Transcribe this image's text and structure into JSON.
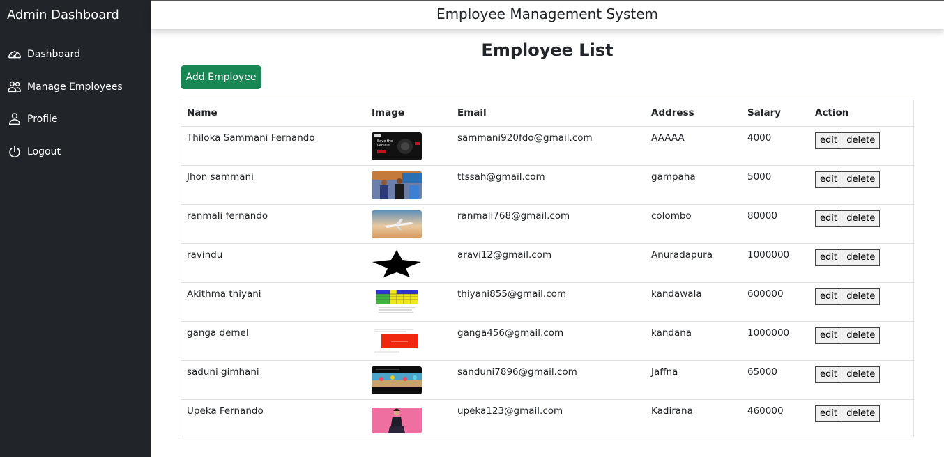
{
  "sidebar": {
    "brand": "Admin Dashboard",
    "items": [
      {
        "label": "Dashboard",
        "icon": "speedometer-icon"
      },
      {
        "label": "Manage Employees",
        "icon": "people-icon"
      },
      {
        "label": "Profile",
        "icon": "person-icon"
      },
      {
        "label": "Logout",
        "icon": "power-icon"
      }
    ]
  },
  "header": {
    "title": "Employee Management System"
  },
  "main": {
    "title": "Employee List",
    "add_button": "Add Employee",
    "columns": [
      "Name",
      "Image",
      "Email",
      "Address",
      "Salary",
      "Action"
    ],
    "rows": [
      {
        "name": "Thiloka Sammani Fernando",
        "email": "sammani920fdo@gmail.com",
        "address": "AAAAA",
        "salary": "4000",
        "image": "dark-website-thumbnail"
      },
      {
        "name": "Jhon sammani",
        "email": "ttssah@gmail.com",
        "address": "gampaha",
        "salary": "5000",
        "image": "graduation-photo-thumbnail"
      },
      {
        "name": "ranmali fernando",
        "email": "ranmali768@gmail.com",
        "address": "colombo",
        "salary": "80000",
        "image": "airplane-sky-thumbnail"
      },
      {
        "name": "ravindu",
        "email": "aravi12@gmail.com",
        "address": "Anuradapura",
        "salary": "1000000",
        "image": "black-star-thumbnail"
      },
      {
        "name": "Akithma thiyani",
        "email": "thiyani855@gmail.com",
        "address": "kandawala",
        "salary": "600000",
        "image": "color-table-thumbnail"
      },
      {
        "name": "ganga demel",
        "email": "ganga456@gmail.com",
        "address": "kandana",
        "salary": "1000000",
        "image": "red-banner-thumbnail"
      },
      {
        "name": "saduni gimhani",
        "email": "sanduni7896@gmail.com",
        "address": "Jaffna",
        "salary": "65000",
        "image": "beach-banner-thumbnail"
      },
      {
        "name": "Upeka Fernando",
        "email": "upeka123@gmail.com",
        "address": "Kadirana",
        "salary": "460000",
        "image": "portrait-pink-thumbnail"
      }
    ],
    "edit_label": "edit",
    "delete_label": "delete"
  },
  "colors": {
    "sidebar": "#212529",
    "primary_button": "#198754",
    "border": "#dee2e6"
  }
}
